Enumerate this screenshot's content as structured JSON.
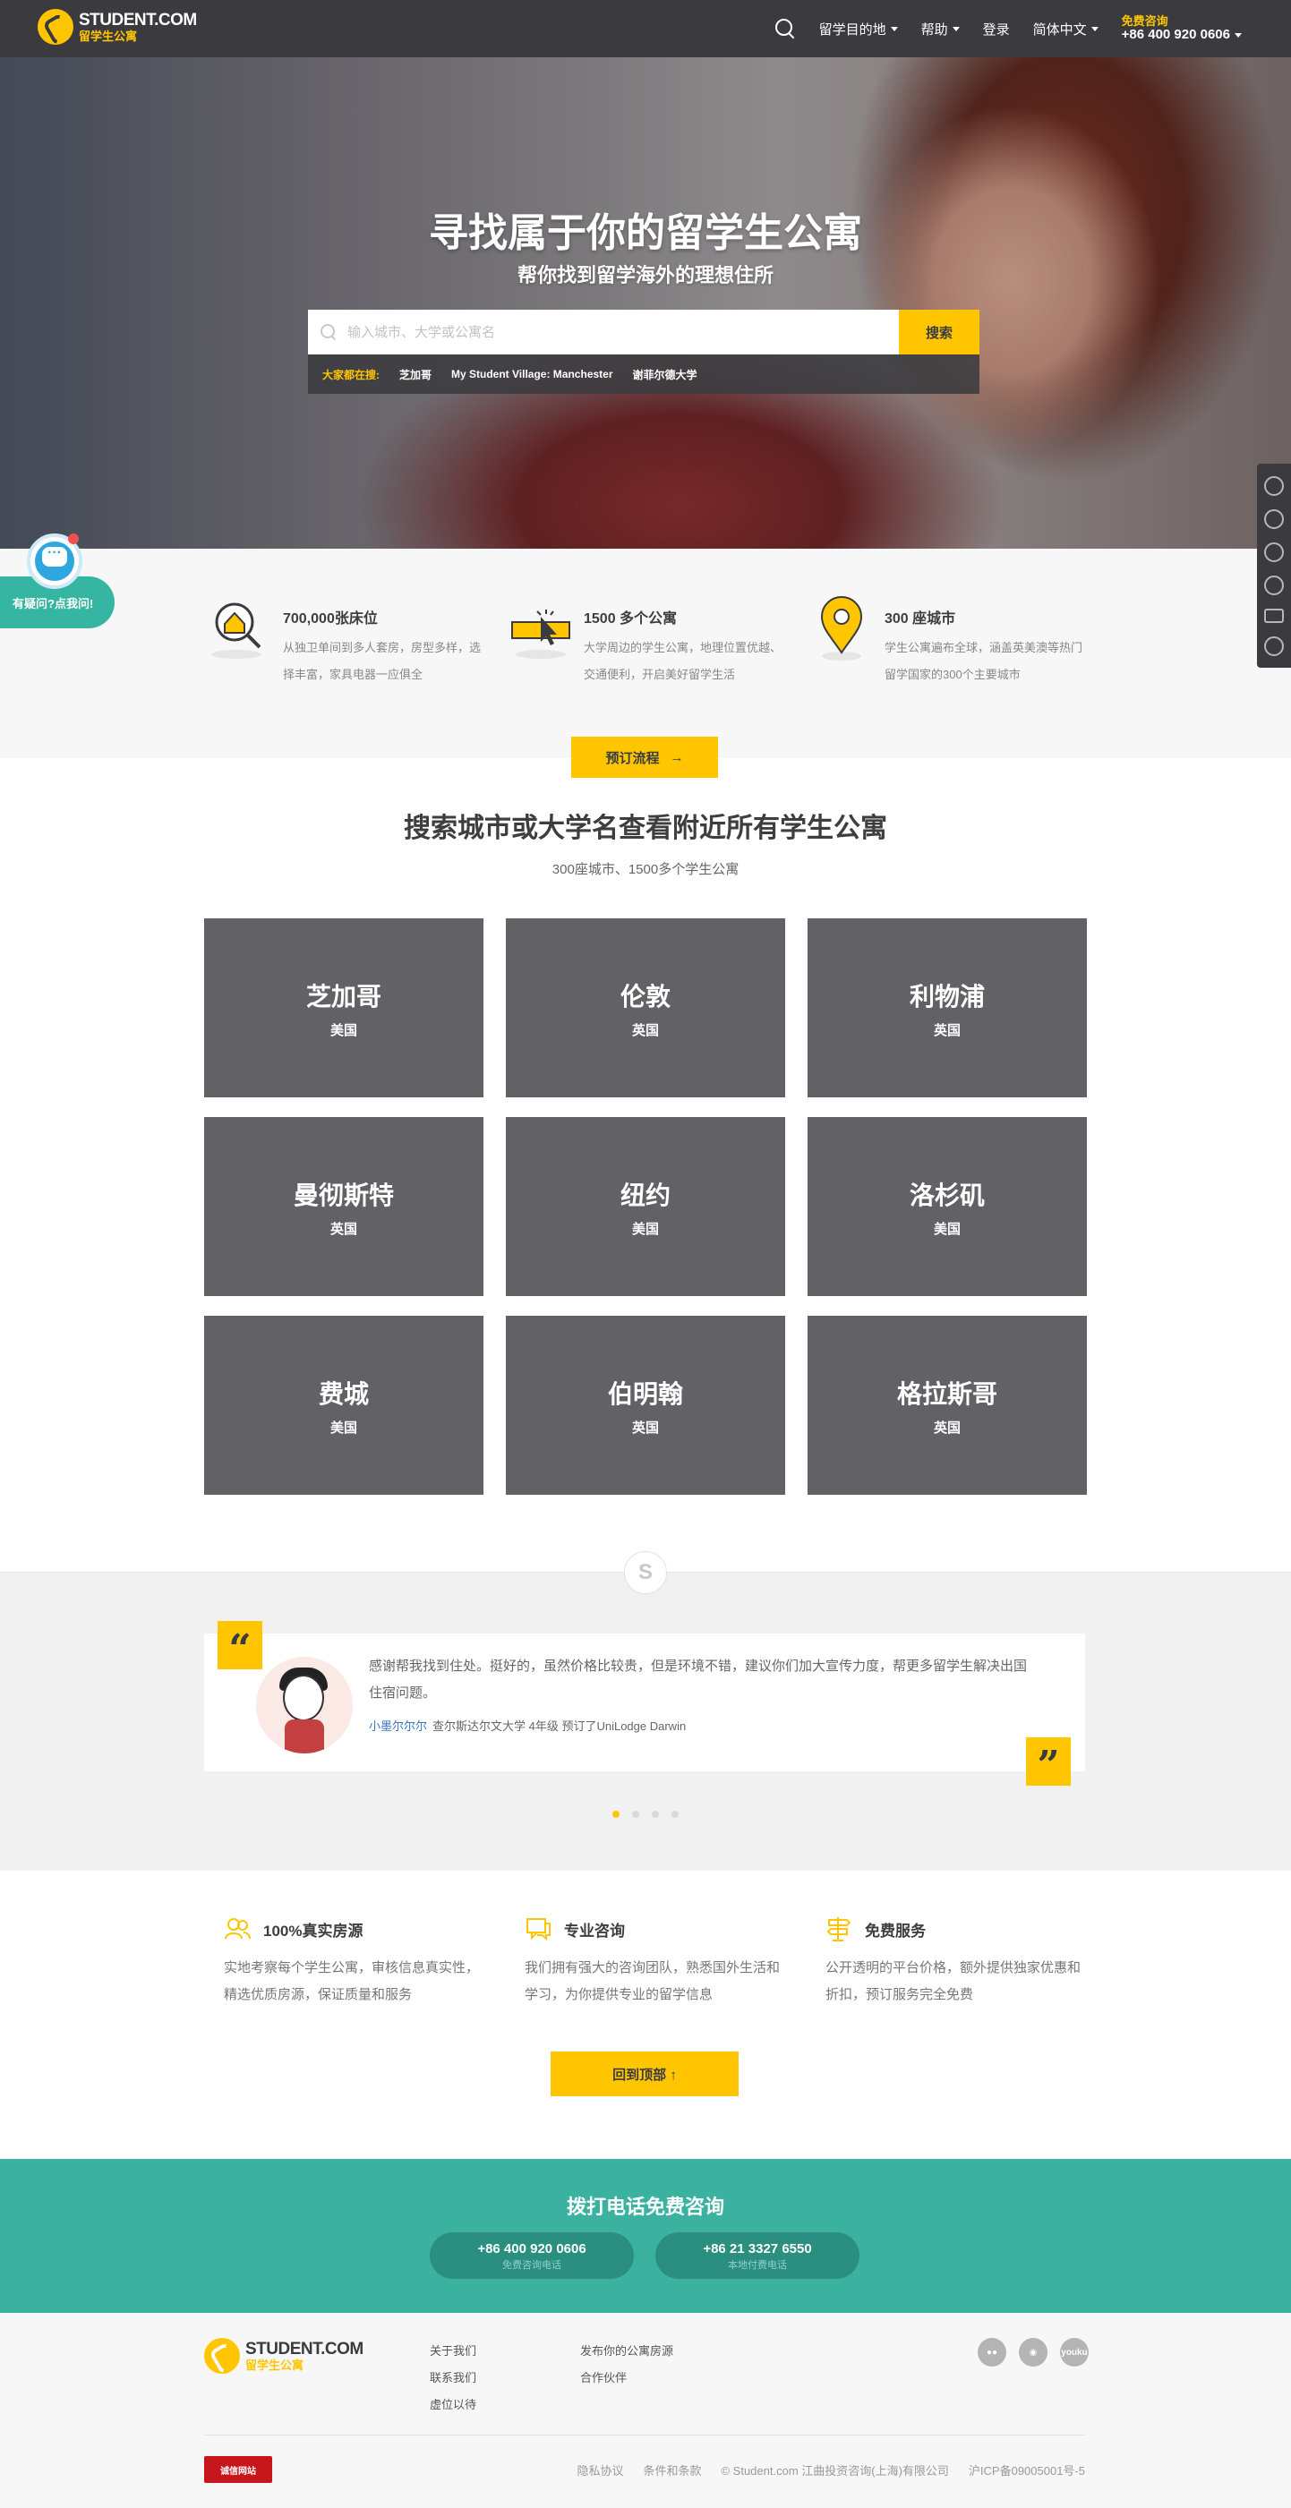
{
  "header": {
    "logo_main": "STUDENT.COM",
    "logo_sub": "留学生公寓",
    "nav": {
      "destinations": "留学目的地",
      "help": "帮助",
      "login": "登录",
      "language": "简体中文"
    },
    "hotline_label": "免费咨询",
    "hotline_number": "+86 400 920 0606"
  },
  "hero": {
    "title": "寻找属于你的留学生公寓",
    "subtitle": "帮你找到留学海外的理想住所",
    "search_placeholder": "输入城市、大学或公寓名",
    "search_button": "搜索",
    "popular_label": "大家都在搜:",
    "popular_links": [
      "芝加哥",
      "My Student Village: Manchester",
      "谢菲尔德大学"
    ]
  },
  "chat": {
    "label": "有疑问?点我问!"
  },
  "side_tools": [
    "phone-icon",
    "wechat-icon",
    "qq-icon",
    "user-icon",
    "mail-icon",
    "share-icon"
  ],
  "features": [
    {
      "icon": "house-search-icon",
      "title": "700,000张床位",
      "desc": "从独卫单间到多人套房，房型多样，选择丰富，家具电器一应俱全"
    },
    {
      "icon": "click-cursor-icon",
      "title": "1500 多个公寓",
      "desc": "大学周边的学生公寓，地理位置优越、交通便利，开启美好留学生活"
    },
    {
      "icon": "map-pin-icon",
      "title": "300 座城市",
      "desc": "学生公寓遍布全球，涵盖英美澳等热门留学国家的300个主要城市"
    }
  ],
  "booking_button": "预订流程",
  "cities_section": {
    "title": "搜索城市或大学名查看附近所有学生公寓",
    "subtitle": "300座城市、1500多个学生公寓",
    "cities": [
      {
        "name": "芝加哥",
        "country": "美国"
      },
      {
        "name": "伦敦",
        "country": "英国"
      },
      {
        "name": "利物浦",
        "country": "英国"
      },
      {
        "name": "曼彻斯特",
        "country": "英国"
      },
      {
        "name": "纽约",
        "country": "美国"
      },
      {
        "name": "洛杉矶",
        "country": "美国"
      },
      {
        "name": "费城",
        "country": "美国"
      },
      {
        "name": "伯明翰",
        "country": "英国"
      },
      {
        "name": "格拉斯哥",
        "country": "英国"
      }
    ]
  },
  "testimonial": {
    "text": "感谢帮我找到住处。挺好的，虽然价格比较贵，但是环境不错，建议你们加大宣传力度，帮更多留学生解决出国住宿问题。",
    "author": "小墨尔尔尔",
    "details": "查尔斯达尔文大学 4年级 预订了UniLodge Darwin",
    "open_quote": "“",
    "close_quote": "”"
  },
  "services": [
    {
      "icon": "people-icon",
      "title": "100%真实房源",
      "desc": "实地考察每个学生公寓，审核信息真实性，精选优质房源，保证质量和服务"
    },
    {
      "icon": "chat-icon",
      "title": "专业咨询",
      "desc": "我们拥有强大的咨询团队，熟悉国外生活和学习，为你提供专业的留学信息"
    },
    {
      "icon": "signpost-icon",
      "title": "免费服务",
      "desc": "公开透明的平台价格，额外提供独家优惠和折扣，预订服务完全免费"
    }
  ],
  "back_to_top": "回到顶部 ↑",
  "consult": {
    "title": "拨打电话免费咨询",
    "phones": [
      {
        "number": "+86 400 920 0606",
        "label": "免费咨询电话"
      },
      {
        "number": "+86 21 3327 6550",
        "label": "本地付费电话"
      }
    ]
  },
  "footer": {
    "col1": [
      "关于我们",
      "联系我们",
      "虚位以待"
    ],
    "col2": [
      "发布你的公寓房源",
      "合作伙伴"
    ],
    "socials": [
      "wechat-icon",
      "weibo-icon",
      "youku-icon"
    ],
    "youku_text": "youku",
    "badge": "诚信网站",
    "bottom_links": [
      "隐私协议",
      "条件和条款",
      "© Student.com 江曲投资咨询(上海)有限公司",
      "沪ICP备09005001号-5"
    ]
  }
}
